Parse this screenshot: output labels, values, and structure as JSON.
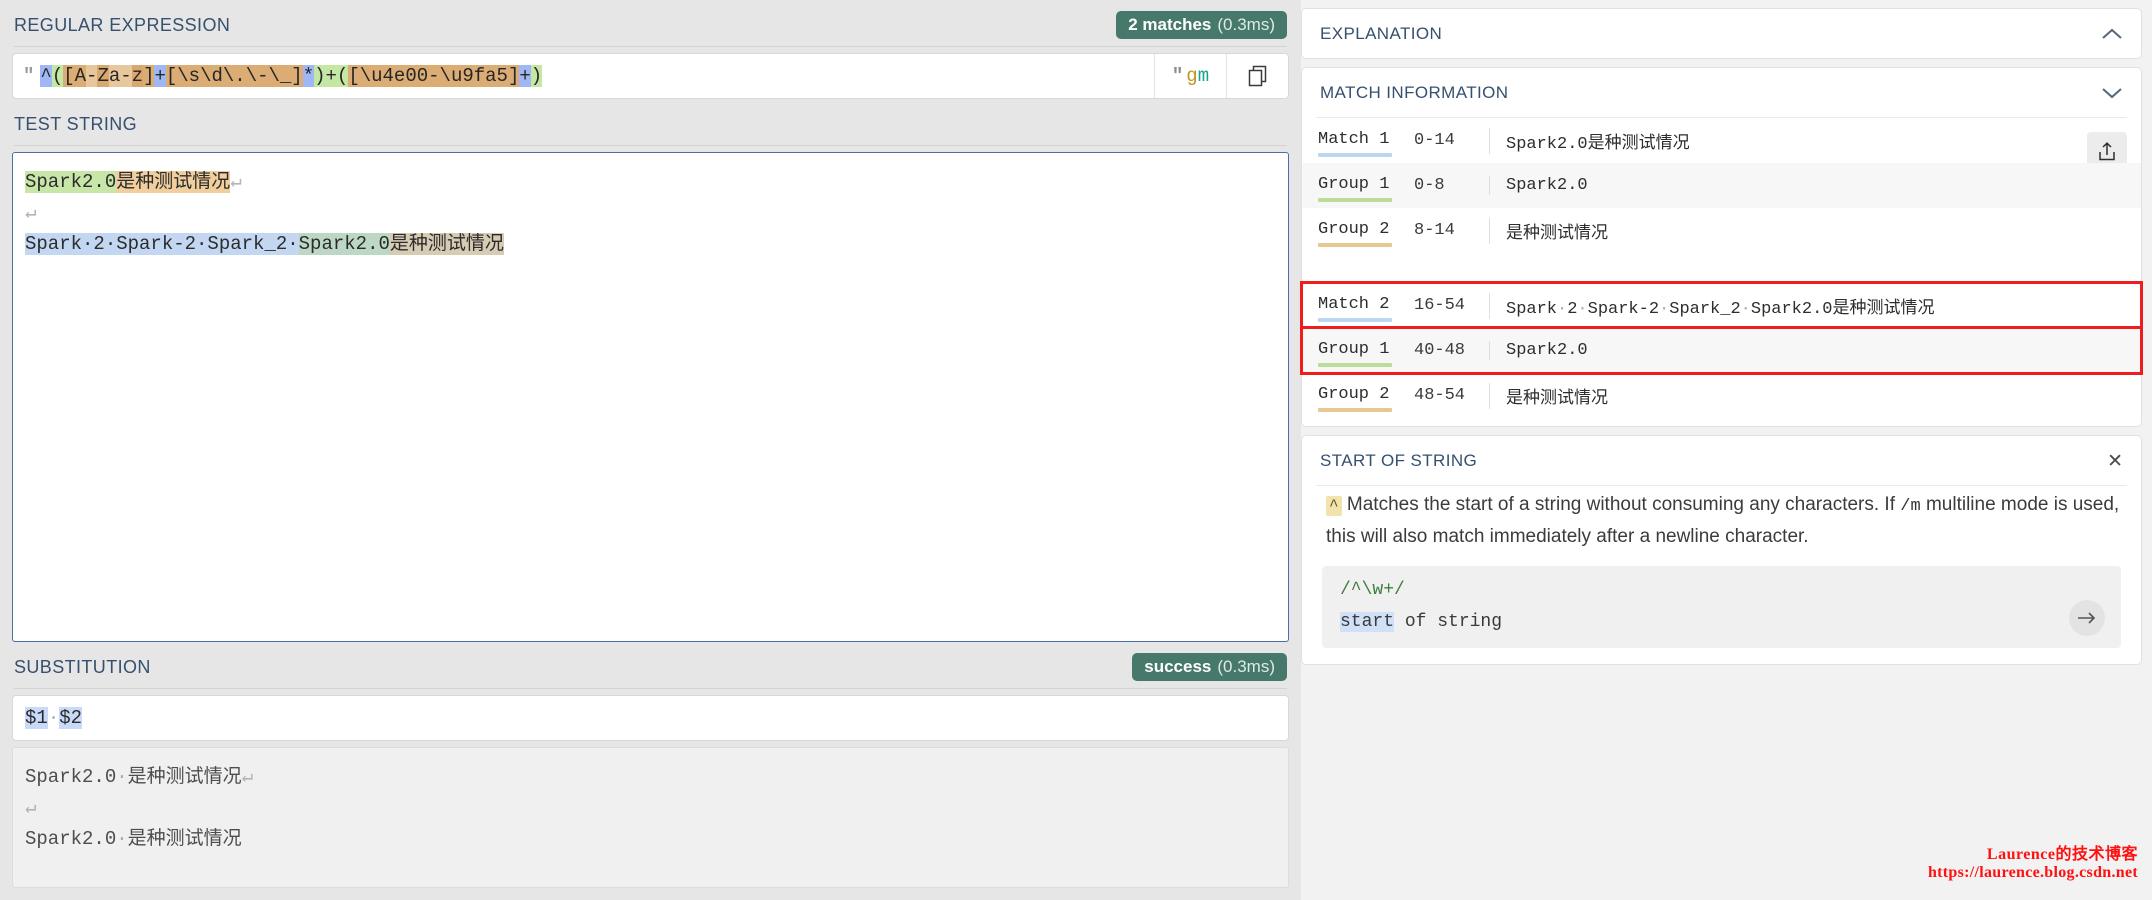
{
  "left": {
    "regex_section": {
      "title": "REGULAR EXPRESSION",
      "badge_main": "2 matches",
      "badge_time": "(0.3ms)",
      "quote": "\"",
      "pattern": "^([A-Za-z]+[\\s\\d\\.\\-\\_]*)+([\\u4e00-\\u9fa5]+)",
      "flags_quote": "\"",
      "flag_g": "g",
      "flag_m": "m",
      "copy_icon": "copy-icon"
    },
    "test_section": {
      "title": "TEST STRING",
      "line1_green": "Spark2.0",
      "line1_tan": "是种测试情况",
      "line1_pilcrow": "↵",
      "line2_pilcrow": "↵",
      "line3_blue": "Spark·2·Spark-2·Spark_2·",
      "line3_bluegreen": "Spark2.0",
      "line3_bluetan": "是种测试情况"
    },
    "substitution_section": {
      "title": "SUBSTITUTION",
      "badge_main": "success",
      "badge_time": "(0.3ms)",
      "tok1": "$1",
      "sep": "·",
      "tok2": "$2",
      "out_line1": "Spark2.0",
      "out_line1_sep": "·",
      "out_line1_cjk": "是种测试情况",
      "out_line1_pilcrow": "↵",
      "out_line2_pilcrow": "↵",
      "out_line3": "Spark2.0",
      "out_line3_sep": "·",
      "out_line3_cjk": "是种测试情况"
    }
  },
  "right": {
    "explanation": {
      "title": "EXPLANATION",
      "chevron": "chevron-up-icon"
    },
    "match_information": {
      "title": "MATCH INFORMATION",
      "chevron": "chevron-down-icon",
      "share_icon": "share-icon",
      "rows": [
        {
          "label": "Match 1",
          "range": "0-14",
          "value_ascii": "Spark2.0",
          "value_cjk": "是种测试情况",
          "underline": "blue",
          "alt": false,
          "highlighted": false
        },
        {
          "label": "Group 1",
          "range": "0-8",
          "value_ascii": "Spark2.0",
          "value_cjk": "",
          "underline": "green",
          "alt": true,
          "highlighted": false
        },
        {
          "label": "Group 2",
          "range": "8-14",
          "value_ascii": "",
          "value_cjk": "是种测试情况",
          "underline": "tan",
          "alt": false,
          "highlighted": false
        },
        {
          "label": "Match 2",
          "range": "16-54",
          "value_ascii": "Spark·2·Spark-2·Spark_2·Spark2.0",
          "value_cjk": "是种测试情况",
          "underline": "blue",
          "alt": false,
          "highlighted": true
        },
        {
          "label": "Group 1",
          "range": "40-48",
          "value_ascii": "Spark2.0",
          "value_cjk": "",
          "underline": "green",
          "alt": true,
          "highlighted": true
        },
        {
          "label": "Group 2",
          "range": "48-54",
          "value_ascii": "",
          "value_cjk": "是种测试情况",
          "underline": "tan",
          "alt": false,
          "highlighted": false
        }
      ]
    },
    "start_of_string": {
      "title": "START OF STRING",
      "close_icon": "close-icon",
      "caret": "^",
      "desc_part1": "Matches the start of a string without consuming any characters. If ",
      "desc_code": "/m",
      "desc_part2": " multiline mode is used, this will also match immediately after a newline character.",
      "example_regex": "/^\\w+/",
      "example_out_hit": "start",
      "example_out_rest": " of string",
      "arrow_icon": "arrow-right-icon"
    }
  },
  "watermark": {
    "line1": "Laurence的技术博客",
    "line2": "https://laurence.blog.csdn.net"
  }
}
